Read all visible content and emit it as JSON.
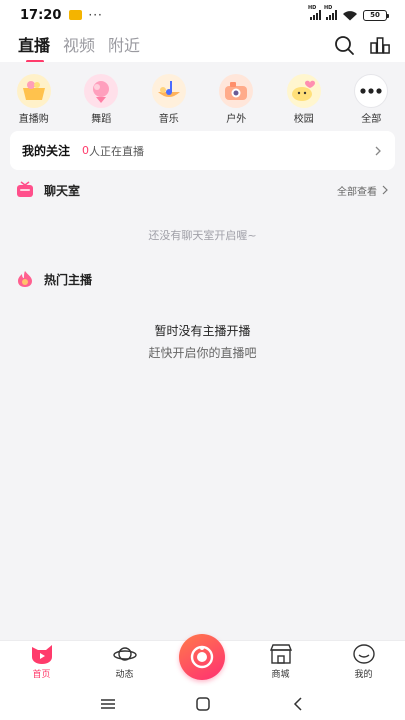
{
  "status_bar": {
    "time": "17:20",
    "dots": "···",
    "sim1": "HD",
    "sim2": "HD",
    "battery": "50"
  },
  "header": {
    "tabs": [
      {
        "label": "直播",
        "active": true
      },
      {
        "label": "视频",
        "active": false
      },
      {
        "label": "附近",
        "active": false
      }
    ],
    "icons": [
      "search-icon",
      "ranking-icon"
    ]
  },
  "categories": [
    {
      "label": "直播购",
      "icon": "shopping-basket-icon",
      "color": "#ffd37a"
    },
    {
      "label": "舞蹈",
      "icon": "dance-icon",
      "color": "#ffb3c8"
    },
    {
      "label": "音乐",
      "icon": "music-icon",
      "color": "#ffd9a0"
    },
    {
      "label": "户外",
      "icon": "camera-icon",
      "color": "#ffc2a8"
    },
    {
      "label": "校园",
      "icon": "campus-icon",
      "color": "#ffe58a"
    },
    {
      "label": "全部",
      "icon": "more-icon",
      "color": "#ffffff"
    }
  ],
  "follow": {
    "title": "我的关注",
    "count": "0",
    "suffix": "人正在直播"
  },
  "chatroom": {
    "title": "聊天室",
    "more": "全部查看",
    "empty": "还没有聊天室开启喔~"
  },
  "hot": {
    "title": "热门主播",
    "empty_title": "暂时没有主播开播",
    "empty_sub": "赶快开启你的直播吧"
  },
  "bottom_nav": {
    "items": [
      {
        "label": "首页",
        "icon": "home-icon",
        "active": true
      },
      {
        "label": "动态",
        "icon": "planet-icon",
        "active": false
      },
      {
        "label": "",
        "icon": "live-camera-icon",
        "active": false
      },
      {
        "label": "商城",
        "icon": "shop-icon",
        "active": false
      },
      {
        "label": "我的",
        "icon": "profile-icon",
        "active": false
      }
    ]
  },
  "colors": {
    "accent": "#ff3b6b",
    "background": "#f4f4f6"
  }
}
